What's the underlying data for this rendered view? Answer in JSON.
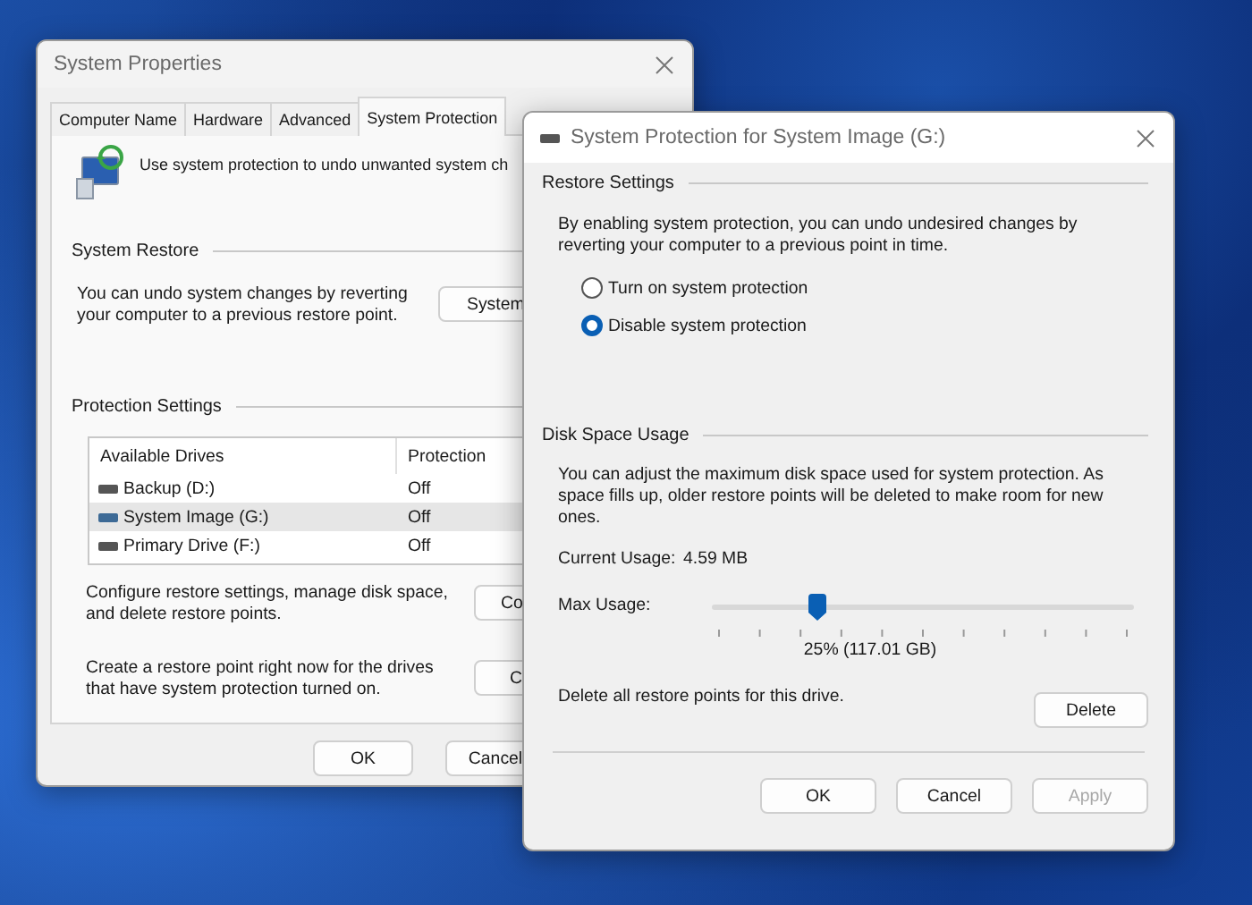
{
  "system_properties": {
    "title": "System Properties",
    "tabs": [
      {
        "label": "Computer Name",
        "selected": false
      },
      {
        "label": "Hardware",
        "selected": false
      },
      {
        "label": "Advanced",
        "selected": false
      },
      {
        "label": "System Protection",
        "selected": true
      }
    ],
    "intro": "Use system protection to undo unwanted system ch",
    "system_restore": {
      "heading": "System Restore",
      "text": "You can undo system changes by reverting your computer to a previous restore point.",
      "button": "System"
    },
    "protection_settings": {
      "heading": "Protection Settings",
      "columns": [
        "Available Drives",
        "Protection"
      ],
      "drives": [
        {
          "name": "Backup (D:)",
          "protection": "Off",
          "selected": false
        },
        {
          "name": "System Image (G:)",
          "protection": "Off",
          "selected": true
        },
        {
          "name": "Primary Drive (F:)",
          "protection": "Off",
          "selected": false
        }
      ],
      "configure_text": "Configure restore settings, manage disk space, and delete restore points.",
      "configure_button": "Co",
      "create_text": "Create a restore point right now for the drives that have system protection turned on.",
      "create_button": "C"
    },
    "buttons": [
      "OK",
      "Cancel"
    ]
  },
  "dialog": {
    "title": "System Protection for System Image (G:)",
    "restore_settings": {
      "heading": "Restore Settings",
      "text": "By enabling system protection, you can undo undesired changes by reverting your computer to a previous point in time.",
      "options": [
        {
          "label": "Turn on system protection",
          "selected": false
        },
        {
          "label": "Disable system protection",
          "selected": true
        }
      ]
    },
    "disk_space": {
      "heading": "Disk Space Usage",
      "text": "You can adjust the maximum disk space used for system protection. As space fills up, older restore points will be deleted to make room for new ones.",
      "current_label": "Current Usage:",
      "current_value": "4.59 MB",
      "max_label": "Max Usage:",
      "max_usage": {
        "level": 0.25
      },
      "max_reading": "25% (117.01 GB)",
      "delete_text": "Delete all restore points for this drive.",
      "delete_button": "Delete"
    },
    "buttons": [
      {
        "label": "OK",
        "disabled": false
      },
      {
        "label": "Cancel",
        "disabled": false
      },
      {
        "label": "Apply",
        "disabled": true
      }
    ]
  }
}
